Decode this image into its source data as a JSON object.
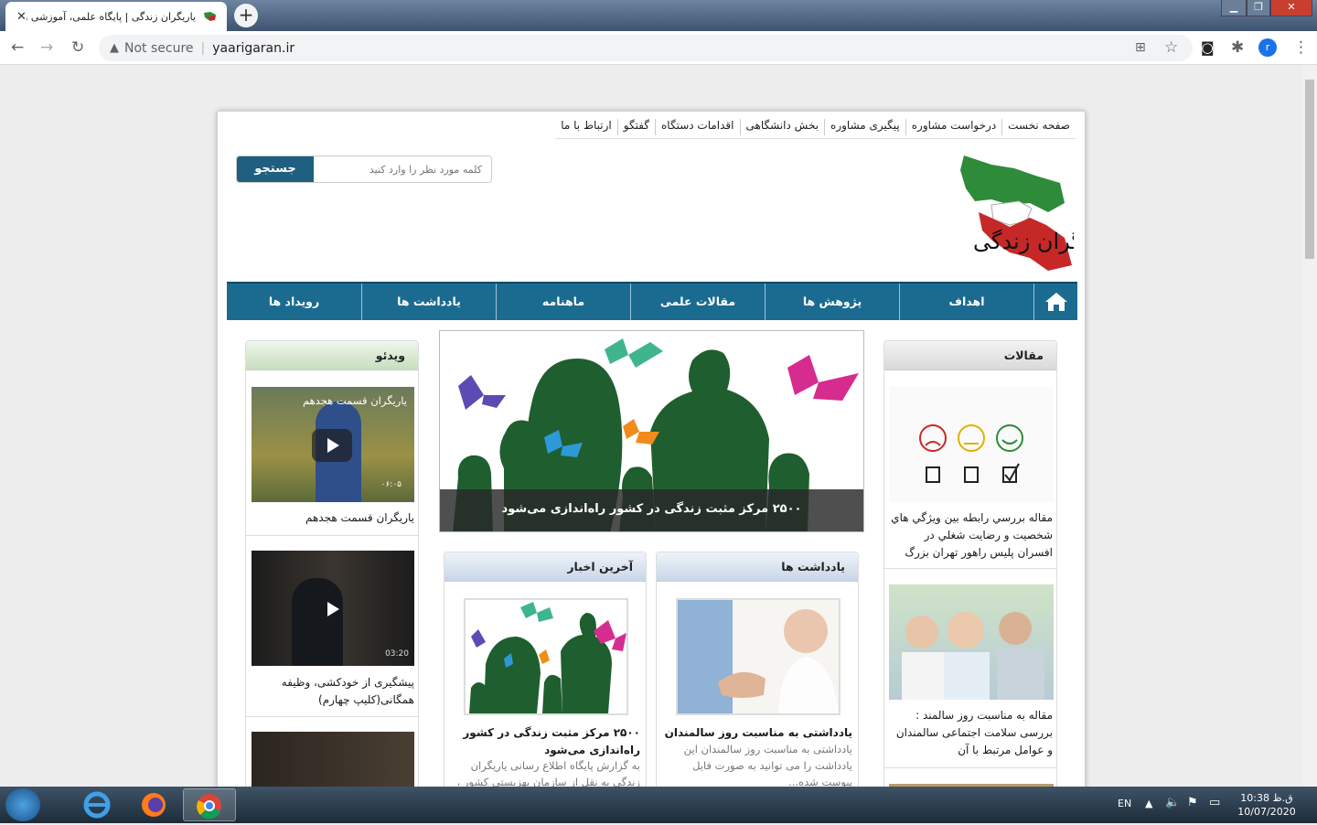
{
  "browser": {
    "tab_title": "یاریگران زندگی | پایگاه علمی، آموزشی و اط",
    "tab_close": "✕",
    "new_tab": "+",
    "security_label": "Not secure",
    "url": "yaarigaran.ir",
    "profile_initial": "r"
  },
  "site": {
    "top_nav": [
      "صفحه نخست",
      "درخواست مشاوره",
      "پیگیری مشاوره",
      "بخش دانشگاهی",
      "اقدامات دستگاه",
      "گفتگو",
      "ارتباط با ما"
    ],
    "search": {
      "placeholder": "کلمه مورد نظر را وارد کنید",
      "button": "جستجو"
    },
    "logo_text": "یاریگران زندگی",
    "main_nav": [
      "اهداف",
      "پژوهش ها",
      "مقالات علمی",
      "ماهنامه",
      "یادداشت ها",
      "رویداد ها"
    ],
    "slider_caption": "۲۵۰۰ مرکز مثبت زندگی در کشور راه‌اندازی می‌شود",
    "articles": {
      "title": "مقالات",
      "items": [
        {
          "caption": "مقاله بررسي رابطه بين ويژگي هاي شخصيت و رضايت شغلي در افسران پليس راهور تهران بزرگ"
        },
        {
          "caption": "مقاله به مناسبت روز سالمند : بررسی سلامت اجتماعی سالمندان و عوامل مرتبط با آن"
        }
      ]
    },
    "notes": {
      "title": "یادداشت ها",
      "item_title": "یادداشتی به مناسبت روز سالمندان",
      "item_text": "یادداشتی به مناسبت روز سالمندان این یادداشت را می توانید به صورت فایل پیوست شده..."
    },
    "news": {
      "title": "آخرین اخبار",
      "item_title": "۲۵۰۰ مرکز مثبت زندگی در کشور راه‌اندازی می‌شود",
      "item_text": "به گزارش پایگاه اطلاع رسانی یاریگران زندگی به نقل از سازمان بهزیستی کشور ،"
    },
    "video": {
      "title": "ویدئو",
      "items": [
        {
          "overlay": "یاریگران قسمت هجدهم",
          "duration": "۰۶:۰۵",
          "caption": "یاریگران قسمت هجدهم"
        },
        {
          "overlay": "",
          "duration": "03:20",
          "caption": "پیشگیری از خودکشی، وظیفه همگانی(کلیپ چهارم)"
        }
      ]
    }
  },
  "taskbar": {
    "lang": "EN",
    "time": "10:38 ق.ظ",
    "date": "10/07/2020"
  },
  "colors": {
    "nav_blue": "#1b6b91",
    "search_btn": "#1f5f7f",
    "tree_green": "#1f5e2f"
  }
}
